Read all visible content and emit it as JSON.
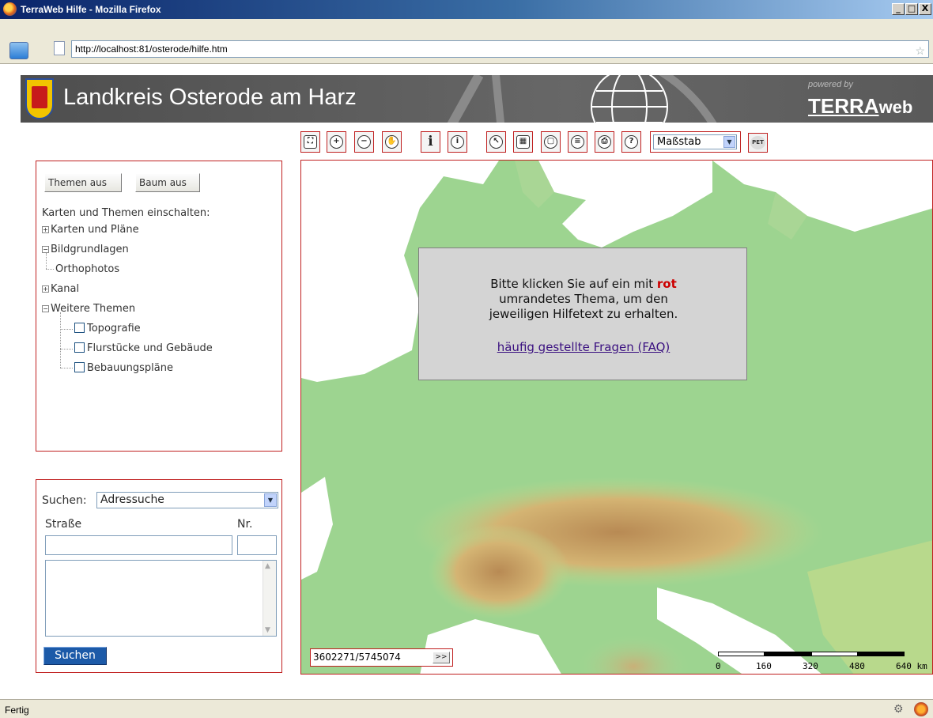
{
  "window": {
    "title": "TerraWeb Hilfe - Mozilla Firefox",
    "controls": [
      "_",
      "□",
      "X"
    ]
  },
  "browser": {
    "url": "http://localhost:81/osterode/hilfe.htm",
    "status": "Fertig"
  },
  "header": {
    "title": "Landkreis Osterode am Harz",
    "powered_by": "powered by",
    "logo_terra": "TERRA",
    "logo_web": "web"
  },
  "toolbar": {
    "tools": [
      {
        "icon": "full-extent-icon",
        "glyph": "⛶"
      },
      {
        "icon": "zoom-in-icon",
        "glyph": "+"
      },
      {
        "icon": "zoom-out-icon",
        "glyph": "−"
      },
      {
        "icon": "pan-hand-icon",
        "glyph": "✋"
      },
      {
        "icon": "info-icon",
        "glyph": "i"
      },
      {
        "icon": "info-detail-icon",
        "glyph": "i"
      },
      {
        "icon": "select-icon",
        "glyph": "↖"
      },
      {
        "icon": "measure-icon",
        "glyph": "▦"
      },
      {
        "icon": "overview-icon",
        "glyph": "▢"
      },
      {
        "icon": "legend-icon",
        "glyph": "≡"
      },
      {
        "icon": "print-icon",
        "glyph": "⎙"
      },
      {
        "icon": "help-icon",
        "glyph": "?"
      }
    ],
    "scale_select": "Maßstab",
    "pet_label": "PET"
  },
  "themes": {
    "themes_off": "Themen aus",
    "tree_off": "Baum aus",
    "heading": "Karten und Themen einschalten:",
    "tree": [
      {
        "label": "Karten und Pläne",
        "expander": "+"
      },
      {
        "label": "Bildgrundlagen",
        "expander": "−"
      },
      {
        "label": "Orthophotos"
      },
      {
        "label": "Kanal",
        "expander": "+"
      },
      {
        "label": "Weitere Themen",
        "expander": "−"
      },
      {
        "label": "Topografie"
      },
      {
        "label": "Flurstücke und Gebäude"
      },
      {
        "label": "Bebauungspläne"
      }
    ]
  },
  "search": {
    "label": "Suchen:",
    "type": "Adressuche",
    "street_label": "Straße",
    "number_label": "Nr.",
    "street_value": "",
    "number_value": "",
    "button": "Suchen"
  },
  "map": {
    "popup_line1_before": "Bitte klicken Sie auf ein mit ",
    "popup_red": "rot",
    "popup_line2": "umrandetes Thema, um den",
    "popup_line3": "jeweiligen Hilfetext zu erhalten.",
    "faq_link": "häufig gestellte Fragen (FAQ)",
    "coordinates": "3602271/5745074",
    "coord_go": ">>",
    "scale_labels": [
      "0",
      "160",
      "320",
      "480",
      "640 km"
    ]
  },
  "colors": {
    "panel_border": "#c02020",
    "map_land": "#9dd490",
    "map_sea": "#ffffff",
    "mountains": "#c8a060"
  }
}
